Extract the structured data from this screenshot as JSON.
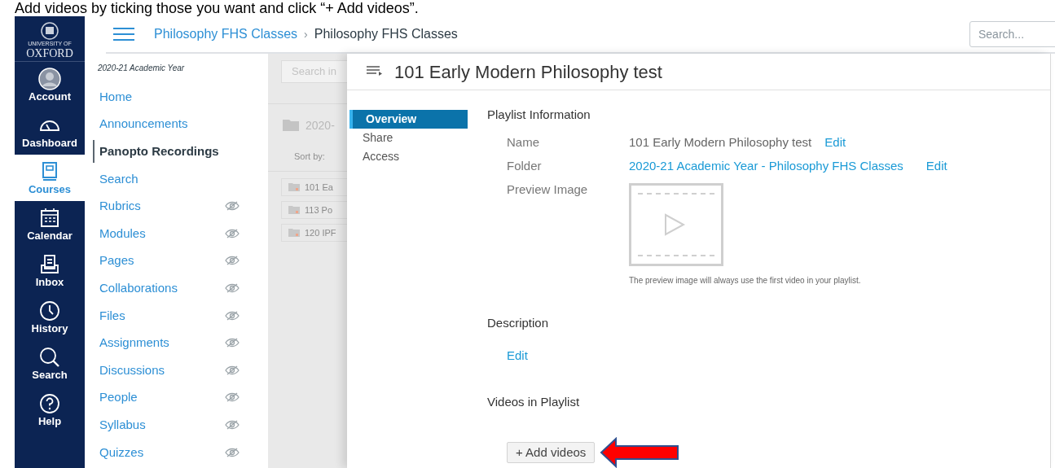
{
  "caption": "Add videos by ticking those you want and click “+ Add videos”.",
  "global_nav": {
    "logo": {
      "line1": "UNIVERSITY OF",
      "line2": "OXFORD"
    },
    "items": [
      {
        "label": "Account",
        "selected": false
      },
      {
        "label": "Dashboard",
        "selected": false
      },
      {
        "label": "Courses",
        "selected": true
      },
      {
        "label": "Calendar",
        "selected": false
      },
      {
        "label": "Inbox",
        "selected": false
      },
      {
        "label": "History",
        "selected": false
      },
      {
        "label": "Search",
        "selected": false
      },
      {
        "label": "Help",
        "selected": false
      }
    ]
  },
  "header": {
    "breadcrumbs": [
      "Philosophy FHS Classes",
      "Philosophy FHS Classes"
    ],
    "separator": "›",
    "search": {
      "placeholder": "Search..."
    }
  },
  "course_nav": {
    "term": "2020-21 Academic Year",
    "items": [
      {
        "label": "Home",
        "selected": false,
        "hidden": false
      },
      {
        "label": "Announcements",
        "selected": false,
        "hidden": false
      },
      {
        "label": "Panopto Recordings",
        "selected": true,
        "hidden": false
      },
      {
        "label": "Search",
        "selected": false,
        "hidden": false
      },
      {
        "label": "Rubrics",
        "selected": false,
        "hidden": true
      },
      {
        "label": "Modules",
        "selected": false,
        "hidden": true
      },
      {
        "label": "Pages",
        "selected": false,
        "hidden": true
      },
      {
        "label": "Collaborations",
        "selected": false,
        "hidden": true
      },
      {
        "label": "Files",
        "selected": false,
        "hidden": true
      },
      {
        "label": "Assignments",
        "selected": false,
        "hidden": true
      },
      {
        "label": "Discussions",
        "selected": false,
        "hidden": true
      },
      {
        "label": "People",
        "selected": false,
        "hidden": true
      },
      {
        "label": "Syllabus",
        "selected": false,
        "hidden": true
      },
      {
        "label": "Quizzes",
        "selected": false,
        "hidden": true
      }
    ]
  },
  "panopto_background": {
    "search_placeholder": "Search in",
    "folder": "2020-",
    "sort_label": "Sort by:",
    "folders": [
      "101 Ea",
      "113 Po",
      "120 IPF"
    ]
  },
  "playlist": {
    "title": "101 Early Modern Philosophy test",
    "tabs": [
      {
        "label": "Overview",
        "selected": true
      },
      {
        "label": "Share",
        "selected": false
      },
      {
        "label": "Access",
        "selected": false
      }
    ],
    "info_heading": "Playlist Information",
    "fields": [
      {
        "kind": "text",
        "label": "Name",
        "value": "101 Early Modern Philosophy test",
        "action": "Edit"
      },
      {
        "kind": "link",
        "label": "Folder",
        "value": "2020-21 Academic Year - Philosophy FHS Classes",
        "action": "Edit"
      },
      {
        "kind": "image",
        "label": "Preview Image",
        "note": "The preview image will always use the first video in your playlist."
      }
    ],
    "description": {
      "heading": "Description",
      "action": "Edit"
    },
    "videos": {
      "heading": "Videos in Playlist",
      "button": "+ Add videos"
    }
  }
}
